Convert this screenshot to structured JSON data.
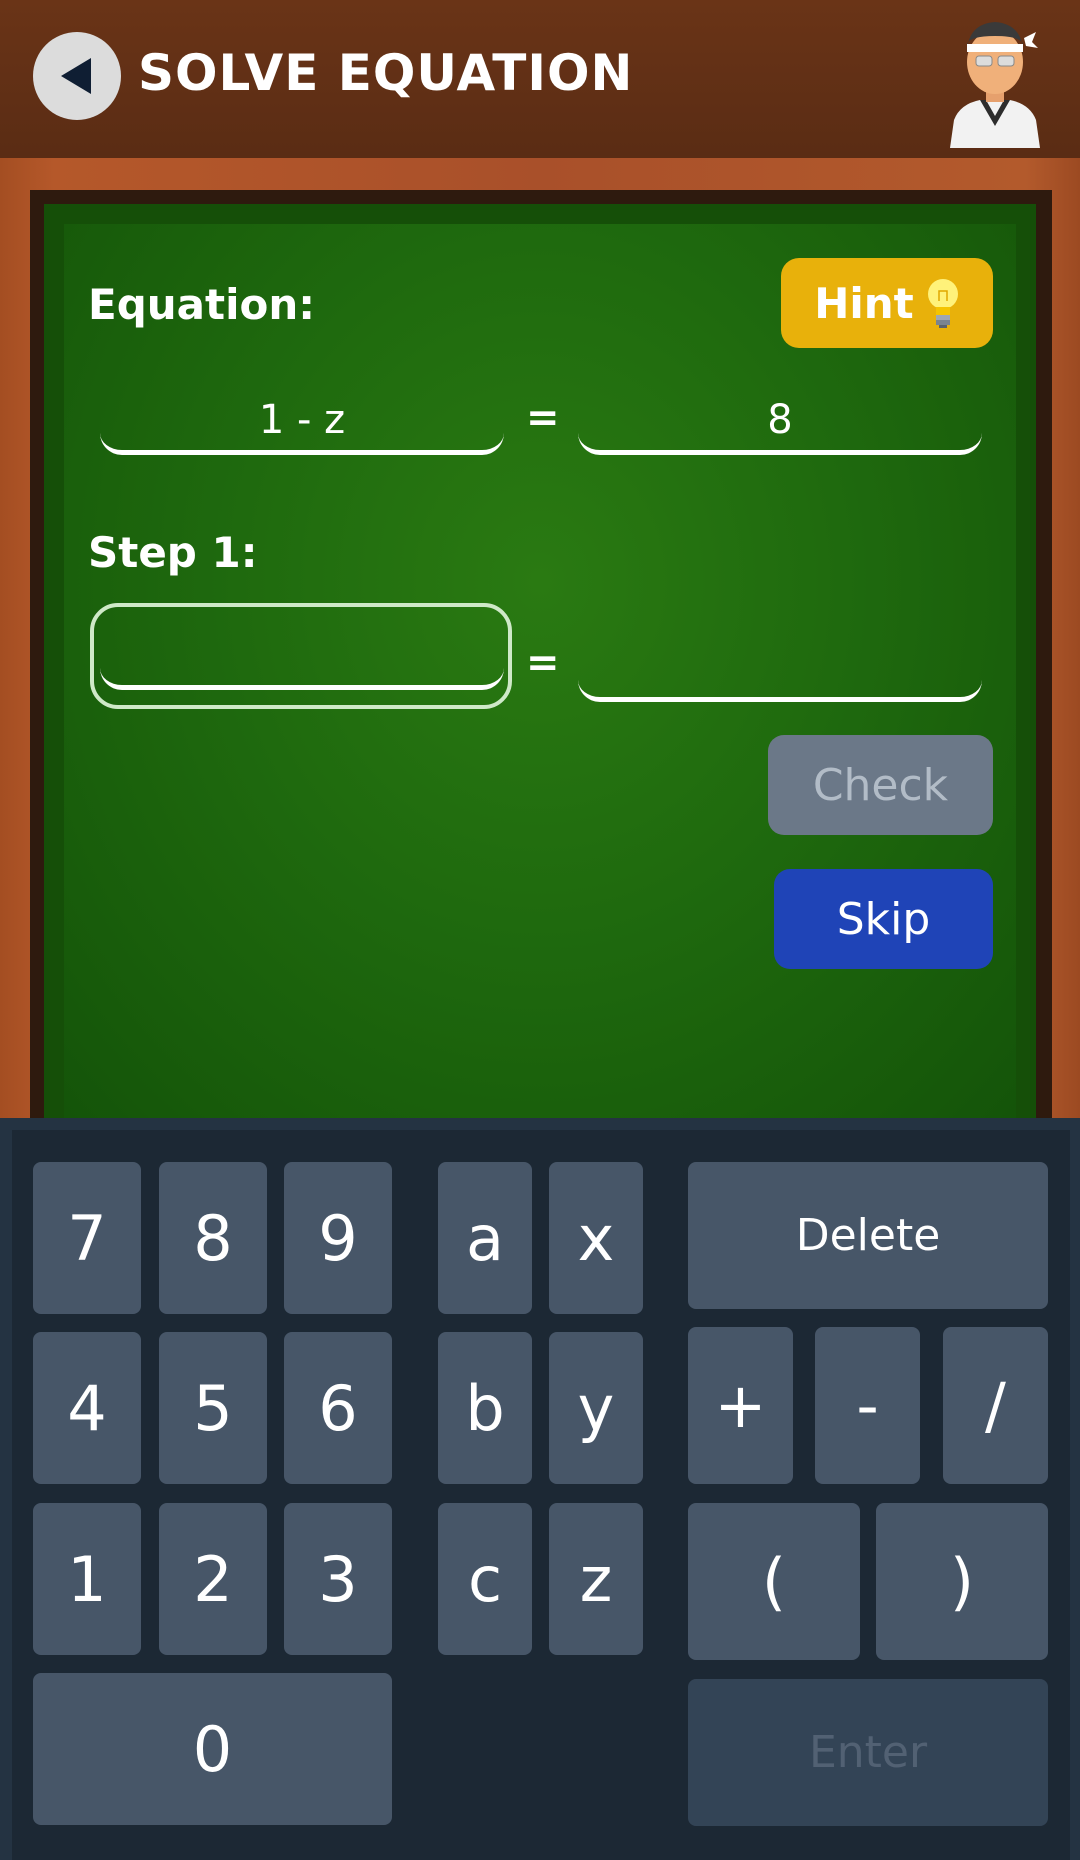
{
  "header": {
    "title": "SOLVE EQUATION"
  },
  "board": {
    "equation_label": "Equation:",
    "hint_label": "Hint",
    "equation_left": "1 - z",
    "equation_right": "8",
    "equals": "=",
    "step_label": "Step 1:",
    "step_left_value": "",
    "step_right_value": "",
    "check_label": "Check",
    "skip_label": "Skip"
  },
  "keypad": {
    "digits": {
      "k7": "7",
      "k8": "8",
      "k9": "9",
      "k4": "4",
      "k5": "5",
      "k6": "6",
      "k1": "1",
      "k2": "2",
      "k3": "3",
      "k0": "0"
    },
    "vars": {
      "a": "a",
      "x": "x",
      "b": "b",
      "y": "y",
      "c": "c",
      "z": "z"
    },
    "ops": {
      "plus": "+",
      "minus": "-",
      "divide": "/",
      "lparen": "(",
      "rparen": ")"
    },
    "delete_label": "Delete",
    "enter_label": "Enter"
  },
  "colors": {
    "hint": "#e8b10b",
    "skip": "#1f44b7",
    "check_disabled": "#6b7888",
    "board_green": "#1f6a0e",
    "key": "#475668"
  }
}
